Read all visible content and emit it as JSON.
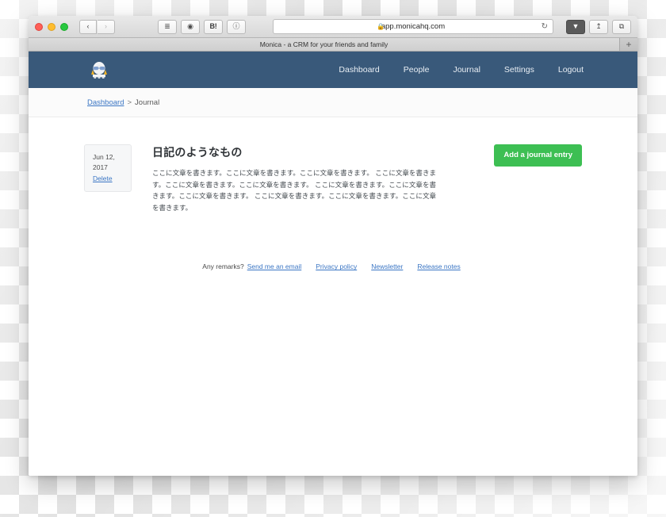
{
  "browser": {
    "traffic_lights": [
      "close",
      "minimize",
      "zoom"
    ],
    "back_label": "‹",
    "forward_label": "›",
    "extensions": [
      {
        "name": "pocket-layers-icon",
        "label": "≣"
      },
      {
        "name": "camera-icon",
        "label": "◉"
      },
      {
        "name": "hatena-bookmark-icon",
        "label": "B!"
      },
      {
        "name": "info-circle-icon",
        "label": "ⓘ"
      }
    ],
    "url": "app.monicahq.com",
    "lock_icon": "🔒",
    "reload_icon": "↻",
    "right_buttons": [
      {
        "name": "downloads-icon",
        "label": "⬇"
      },
      {
        "name": "share-icon",
        "label": "⇧"
      },
      {
        "name": "show-tabs-icon",
        "label": "⧉"
      }
    ],
    "tab_title": "Monica - a CRM for your friends and family",
    "new_tab_label": "+"
  },
  "navbar": {
    "brand_name": "monica-logo",
    "links": [
      {
        "label": "Dashboard"
      },
      {
        "label": "People"
      },
      {
        "label": "Journal"
      },
      {
        "label": "Settings"
      },
      {
        "label": "Logout"
      }
    ]
  },
  "breadcrumb": {
    "home_label": "Dashboard",
    "separator": ">",
    "current_label": "Journal"
  },
  "journal": {
    "add_button_label": "Add a journal entry",
    "entry": {
      "date_line1": "Jun 12,",
      "date_line2": "2017",
      "delete_label": "Delete",
      "title": "日記のようなもの",
      "body": "ここに文章を書きます。ここに文章を書きます。ここに文章を書きます。 ここに文章を書きます。ここに文章を書きます。ここに文章を書きます。 ここに文章を書きます。ここに文章を書きます。ここに文章を書きます。 ここに文章を書きます。ここに文章を書きます。ここに文章を書きます。"
    }
  },
  "footer": {
    "remarks_label": "Any remarks?",
    "links": [
      {
        "label": "Send me an email"
      },
      {
        "label": "Privacy policy"
      },
      {
        "label": "Newsletter"
      },
      {
        "label": "Release notes"
      }
    ]
  },
  "colors": {
    "navbar": "#39597a",
    "accent_green": "#3dbf53",
    "link_blue": "#3b76c4"
  }
}
